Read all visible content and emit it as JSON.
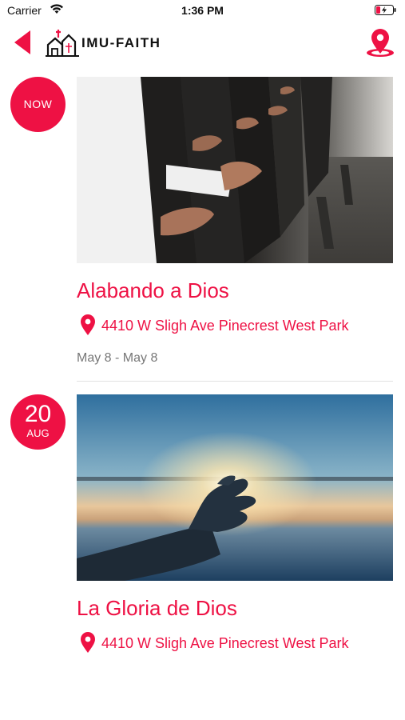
{
  "status_bar": {
    "carrier": "Carrier",
    "time": "1:36 PM"
  },
  "header": {
    "app_name": "IMU-FAITH"
  },
  "colors": {
    "accent": "#ee1144",
    "badge": "#ee1144",
    "muted_text": "#777777"
  },
  "events": [
    {
      "badge": "NOW",
      "title": "Alabando a Dios",
      "location": "4410 W Sligh Ave Pinecrest West Park",
      "dates": "May 8 - May 8",
      "image_icon": "worship-hands-photo"
    },
    {
      "badge_day": "20",
      "badge_month": "AUG",
      "title": "La Gloria de Dios",
      "location": "4410 W Sligh Ave Pinecrest West Park",
      "image_icon": "sunset-hand-photo"
    }
  ]
}
